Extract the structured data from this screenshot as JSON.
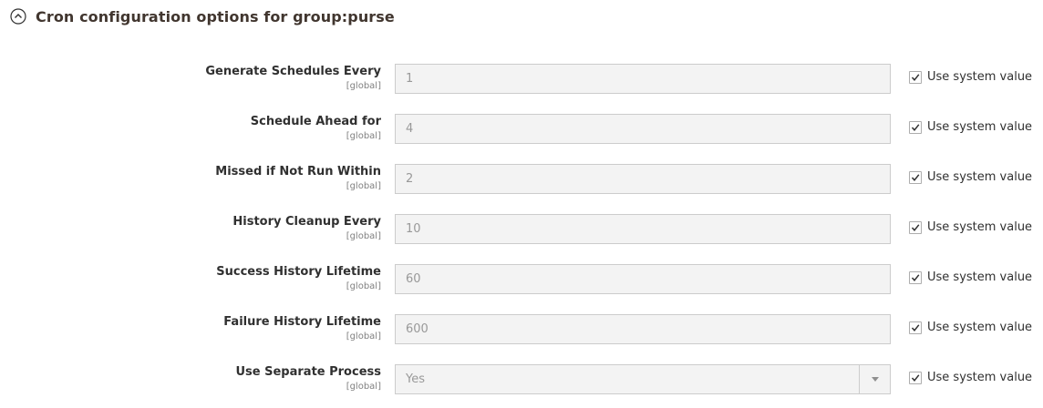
{
  "section": {
    "title": "Cron configuration options for group:purse",
    "toggle_icon": "chevron-up-circle-icon"
  },
  "fields": [
    {
      "label": "Generate Schedules Every",
      "scope": "[global]",
      "value": "1"
    },
    {
      "label": "Schedule Ahead for",
      "scope": "[global]",
      "value": "4"
    },
    {
      "label": "Missed if Not Run Within",
      "scope": "[global]",
      "value": "2"
    },
    {
      "label": "History Cleanup Every",
      "scope": "[global]",
      "value": "10"
    },
    {
      "label": "Success History Lifetime",
      "scope": "[global]",
      "value": "60"
    },
    {
      "label": "Failure History Lifetime",
      "scope": "[global]",
      "value": "600"
    },
    {
      "label": "Use Separate Process",
      "scope": "[global]",
      "value": "Yes",
      "type": "select"
    }
  ],
  "inherit_label": "Use system value",
  "inherit_checked": true,
  "colors": {
    "title": "#41362f",
    "input_bg": "#f3f3f3",
    "input_border": "#cccccc",
    "disabled_text": "#999999"
  }
}
